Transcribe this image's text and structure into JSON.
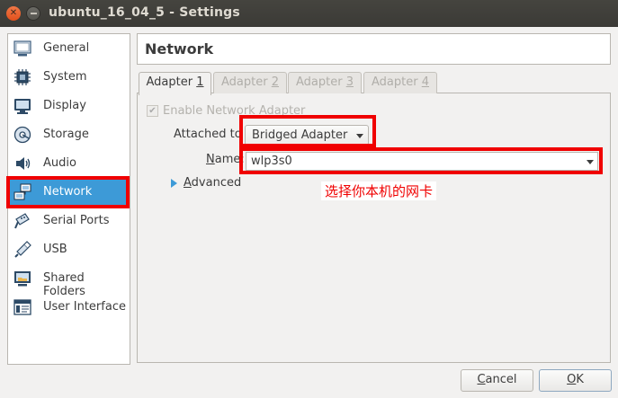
{
  "window": {
    "title": "ubuntu_16_04_5 - Settings"
  },
  "sidebar": {
    "items": [
      {
        "label": "General",
        "icon": "general-icon"
      },
      {
        "label": "System",
        "icon": "system-chip-icon"
      },
      {
        "label": "Display",
        "icon": "display-monitor-icon"
      },
      {
        "label": "Storage",
        "icon": "storage-disk-icon"
      },
      {
        "label": "Audio",
        "icon": "audio-speaker-icon"
      },
      {
        "label": "Network",
        "icon": "network-icon",
        "selected": true
      },
      {
        "label": "Serial Ports",
        "icon": "serial-port-icon"
      },
      {
        "label": "USB",
        "icon": "usb-icon"
      },
      {
        "label": "Shared Folders",
        "icon": "shared-folder-icon"
      },
      {
        "label": "User Interface",
        "icon": "user-interface-icon"
      }
    ]
  },
  "header": {
    "title": "Network"
  },
  "tabs": [
    {
      "label_prefix": "Adapter ",
      "label_key": "1",
      "active": true
    },
    {
      "label_prefix": "Adapter ",
      "label_key": "2",
      "active": false
    },
    {
      "label_prefix": "Adapter ",
      "label_key": "3",
      "active": false
    },
    {
      "label_prefix": "Adapter ",
      "label_key": "4",
      "active": false
    }
  ],
  "form": {
    "enable_label": "Enable Network Adapter",
    "enable_checked": true,
    "attached_label": "Attached to",
    "attached_value": "Bridged Adapter",
    "name_label_key": "N",
    "name_label_rest": "ame:",
    "name_value": "wlp3s0",
    "advanced_key": "A",
    "advanced_rest": "dvanced"
  },
  "annotation": {
    "text": "选择你本机的网卡",
    "color": "#f00000"
  },
  "buttons": {
    "cancel_key": "C",
    "cancel_rest": "ancel",
    "ok_key": "O",
    "ok_rest": "K"
  },
  "colors": {
    "accent": "#3d9ad7",
    "highlight_box": "#f00000",
    "titlebar": "#3b3a36"
  }
}
